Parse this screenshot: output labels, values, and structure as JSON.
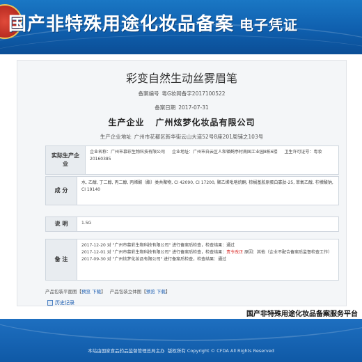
{
  "header": {
    "title": "国产非特殊用途化妆品备案",
    "subtitle": "电子凭证"
  },
  "product": {
    "name": "彩变自然生动丝雾眉笔",
    "record_no_label": "备案编号",
    "record_no": "粤G妆网备字2017100522",
    "record_date_label": "备案日期",
    "record_date": "2017-07-31",
    "producer_label": "生产企业",
    "producer_name": "广州炫梦化妆品有限公司",
    "producer_addr_label": "生产企业地址",
    "producer_addr": "广州市花都区新华街云山大道52号8座201周铺之103号"
  },
  "rows": {
    "actual_producer": {
      "label": "实际生产企业",
      "company_label": "企业名称：",
      "company": "广州市慕彩生物科技有限公司",
      "address_label": "企业地址：",
      "address": "广州市白云区人和镇鹤亭村南国工业园8栋6楼",
      "license_label": "卫生许可证号：",
      "license": "粤妆20160385"
    },
    "ingredients": {
      "label": "成 分",
      "text": "水, 乙醇, 丁二醇, 丙二醇, 丙烯酸（酯）类共聚物, CI 42090, CI 17200, 聚乙烯吡咯烷酮, 棕榈基胶原蛋白寡肽-25, 苯氧乙醇, 柠檬酸钠, CI 19140"
    },
    "description": {
      "label": "说 明",
      "text": "1.5G"
    },
    "remarks": {
      "label": "备 注",
      "line1": "2017-12-20 对 \"广州市慕彩生物科技有限公司\" 进行备案后检查，检查结果：通过",
      "line2_pre": "2017-12-01 对 \"广州市慕彩生物科技有限公司\" 进行备案后检查，检查结果：",
      "line2_red": "责令改正",
      "line2_post": " 原因：其他（企业不配合备案后监督检查工作）",
      "line3": "2017-09-30 对 \"广州炫梦化妆品有限公司\" 进行备案后检查，检查结果：通过"
    }
  },
  "docs": {
    "plan_label": "产品包装平面图",
    "preview": "预览",
    "download": "下载",
    "stereo_label": "产品包装立体图"
  },
  "history_label": "历史记录",
  "platform_name": "国产非特殊用途化妆品备案服务平台",
  "footer": {
    "host_pre": "本站由",
    "host_org": "国家食品药品监督管理总局",
    "host_post": "主办",
    "copyright": "版权所有 Copyright © CFDA All Rights Reserved"
  },
  "colors": {
    "banner": "#1a77c4",
    "footer": "#1e6fc0",
    "link": "#1a5cb0",
    "warning": "#d8201c"
  }
}
